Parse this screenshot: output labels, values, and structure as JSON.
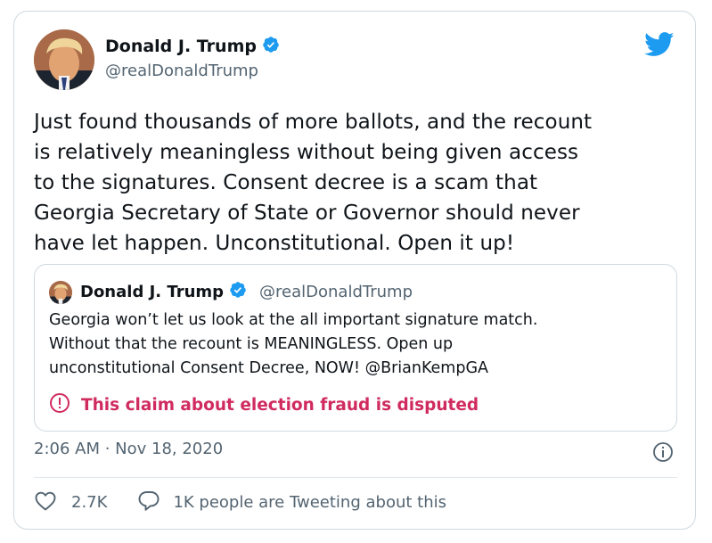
{
  "author": {
    "display_name": "Donald J. Trump",
    "handle": "@realDonaldTrump"
  },
  "tweet": {
    "text": "Just found thousands of more ballots, and the recount\nis relatively meaningless without being given access\nto the signatures. Consent decree is a scam that\nGeorgia Secretary of State or Governor should never\nhave let happen. Unconstitutional. Open it up!",
    "timestamp": "2:06 AM · Nov 18, 2020"
  },
  "quoted_tweet": {
    "display_name": "Donald J. Trump",
    "handle": "@realDonaldTrump",
    "text": "Georgia won’t let us look at the all important signature match.\nWithout that the recount is MEANINGLESS. Open up\nunconstitutional Consent Decree, NOW! @BrianKempGA",
    "dispute_label": "This claim about election fraud is disputed"
  },
  "actions": {
    "like_count": "2.7K",
    "reply_text": "1K people are Tweeting about this"
  },
  "icons": {
    "verified": "verified-badge-icon",
    "brand": "twitter-bird-icon",
    "warning": "exclamation-circle-icon",
    "info": "info-icon",
    "like": "heart-icon",
    "reply": "speech-bubble-icon"
  },
  "colors": {
    "brand_blue": "#1d9bf0",
    "dispute_red": "#d02b5f",
    "secondary_text": "#536471",
    "border": "#cfd9de"
  }
}
